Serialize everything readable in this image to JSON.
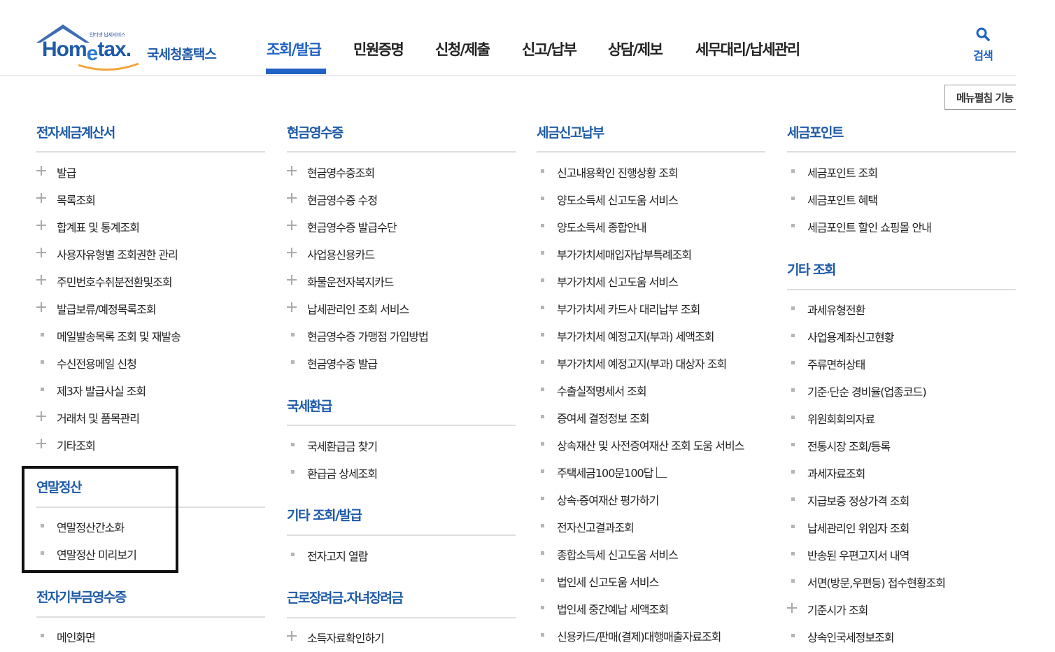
{
  "header": {
    "logo_tagline": "인터넷 납세서비스",
    "logo_word_pre": "Hom",
    "logo_word_e": "e",
    "logo_word_post": "tax.",
    "logo_korean": "국세청홈택스",
    "nav": [
      "조회/발급",
      "민원증명",
      "신청/제출",
      "신고/납부",
      "상담/제보",
      "세무대리/납세관리"
    ],
    "active_nav_index": 0,
    "search_label": "검색",
    "menu_edit_label": "메뉴펼침 기능"
  },
  "columns": [
    {
      "sections": [
        {
          "title": "전자세금계산서",
          "items": [
            {
              "label": "발급",
              "bullet": "plus"
            },
            {
              "label": "목록조회",
              "bullet": "plus"
            },
            {
              "label": "합계표 및 통계조회",
              "bullet": "plus"
            },
            {
              "label": "사용자유형별 조회권한 관리",
              "bullet": "plus"
            },
            {
              "label": "주민번호수취분전환및조회",
              "bullet": "plus"
            },
            {
              "label": "발급보류/예정목록조회",
              "bullet": "plus"
            },
            {
              "label": "메일발송목록 조회 및 재발송",
              "bullet": "dot"
            },
            {
              "label": "수신전용메일 신청",
              "bullet": "dot"
            },
            {
              "label": "제3자 발급사실 조회",
              "bullet": "dot"
            },
            {
              "label": "거래처 및 품목관리",
              "bullet": "plus"
            },
            {
              "label": "기타조회",
              "bullet": "plus"
            }
          ]
        },
        {
          "title": "연말정산",
          "items": [
            {
              "label": "연말정산간소화",
              "bullet": "dot"
            },
            {
              "label": "연말정산 미리보기",
              "bullet": "dot"
            }
          ]
        },
        {
          "title": "전자기부금영수증",
          "items": [
            {
              "label": "메인화면",
              "bullet": "dot"
            }
          ]
        }
      ]
    },
    {
      "sections": [
        {
          "title": "현금영수증",
          "items": [
            {
              "label": "현금영수증조회",
              "bullet": "plus"
            },
            {
              "label": "현금영수증 수정",
              "bullet": "plus"
            },
            {
              "label": "현금영수증 발급수단",
              "bullet": "plus"
            },
            {
              "label": "사업용신용카드",
              "bullet": "plus"
            },
            {
              "label": "화물운전자복지카드",
              "bullet": "plus"
            },
            {
              "label": "납세관리인 조회 서비스",
              "bullet": "plus"
            },
            {
              "label": "현금영수증 가맹점 가입방법",
              "bullet": "dot"
            },
            {
              "label": "현금영수증 발급",
              "bullet": "dot"
            }
          ]
        },
        {
          "title": "국세환급",
          "items": [
            {
              "label": "국세환급금 찾기",
              "bullet": "dot"
            },
            {
              "label": "환급금 상세조회",
              "bullet": "dot"
            }
          ]
        },
        {
          "title": "기타 조회/발급",
          "items": [
            {
              "label": "전자고지 열람",
              "bullet": "dot"
            }
          ]
        },
        {
          "title": "근로장려금.자녀장려금",
          "items": [
            {
              "label": "소득자료확인하기",
              "bullet": "plus"
            }
          ]
        }
      ]
    },
    {
      "sections": [
        {
          "title": "세금신고납부",
          "items": [
            {
              "label": "신고내용확인 진행상황 조회",
              "bullet": "dot"
            },
            {
              "label": "양도소득세 신고도움 서비스",
              "bullet": "dot"
            },
            {
              "label": "양도소득세 종합안내",
              "bullet": "dot"
            },
            {
              "label": "부가가치세매입자납부특례조회",
              "bullet": "dot"
            },
            {
              "label": "부가가치세 신고도움 서비스",
              "bullet": "dot"
            },
            {
              "label": "부가가치세 카드사 대리납부 조회",
              "bullet": "dot"
            },
            {
              "label": "부가가치세 예정고지(부과) 세액조회",
              "bullet": "dot"
            },
            {
              "label": "부가가치세 예정고지(부과) 대상자 조회",
              "bullet": "dot"
            },
            {
              "label": "수출실적명세서 조회",
              "bullet": "dot"
            },
            {
              "label": "증여세 결정정보 조회",
              "bullet": "dot"
            },
            {
              "label": "상속재산 및 사전증여재산 조회 도움 서비스",
              "bullet": "dot"
            },
            {
              "label": "주택세금100문100답",
              "bullet": "dot",
              "external": true
            },
            {
              "label": "상속·증여재산 평가하기",
              "bullet": "dot"
            },
            {
              "label": "전자신고결과조회",
              "bullet": "dot"
            },
            {
              "label": "종합소득세 신고도움 서비스",
              "bullet": "dot"
            },
            {
              "label": "법인세 신고도움 서비스",
              "bullet": "dot"
            },
            {
              "label": "법인세 중간예납 세액조회",
              "bullet": "dot"
            },
            {
              "label": "신용카드/판매(결제)대행매출자료조회",
              "bullet": "dot"
            }
          ]
        }
      ]
    },
    {
      "sections": [
        {
          "title": "세금포인트",
          "items": [
            {
              "label": "세금포인트 조회",
              "bullet": "dot"
            },
            {
              "label": "세금포인트 혜택",
              "bullet": "dot"
            },
            {
              "label": "세금포인트 할인 쇼핑몰 안내",
              "bullet": "dot"
            }
          ]
        },
        {
          "title": "기타 조회",
          "items": [
            {
              "label": "과세유형전환",
              "bullet": "dot"
            },
            {
              "label": "사업용계좌신고현황",
              "bullet": "dot"
            },
            {
              "label": "주류면허상태",
              "bullet": "dot"
            },
            {
              "label": "기준·단순 경비율(업종코드)",
              "bullet": "dot"
            },
            {
              "label": "위원회회의자료",
              "bullet": "dot"
            },
            {
              "label": "전통시장 조회/등록",
              "bullet": "dot"
            },
            {
              "label": "과세자료조회",
              "bullet": "dot"
            },
            {
              "label": "지급보증 정상가격 조회",
              "bullet": "dot"
            },
            {
              "label": "납세관리인 위임자 조회",
              "bullet": "dot"
            },
            {
              "label": "반송된 우편고지서 내역",
              "bullet": "dot"
            },
            {
              "label": "서면(방문,우편등) 접수현황조회",
              "bullet": "dot"
            },
            {
              "label": "기준시가 조회",
              "bullet": "plus"
            },
            {
              "label": "상속인국세정보조회",
              "bullet": "dot"
            }
          ]
        }
      ]
    }
  ],
  "colors": {
    "brand": "#1e5aa8",
    "active": "#2163c4",
    "highlight_border": "#111111"
  }
}
